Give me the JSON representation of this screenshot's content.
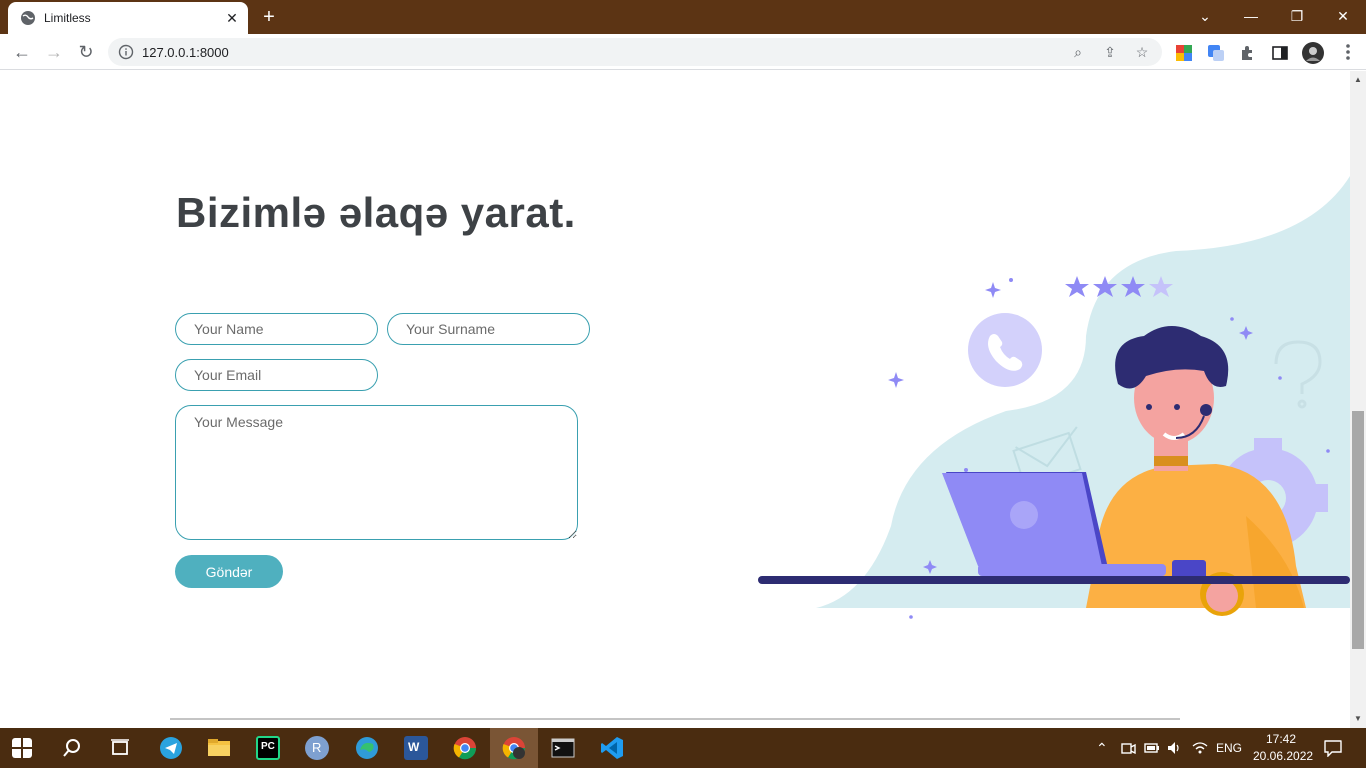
{
  "browser": {
    "tab_title": "Limitless",
    "tab_close": "✕",
    "new_tab": "+",
    "url": "127.0.0.1:8000",
    "window_controls": {
      "chevron": "⌄",
      "minimize": "—",
      "restore": "❐",
      "close": "✕"
    },
    "nav": {
      "back": "←",
      "forward": "→",
      "reload": "↻"
    },
    "omnibox_actions": {
      "zoom": "⌕",
      "share": "⇪",
      "bookmark": "☆"
    }
  },
  "page": {
    "heading": "Bizimlə əlaqə yarat.",
    "form": {
      "name_placeholder": "Your Name",
      "surname_placeholder": "Your Surname",
      "email_placeholder": "Your Email",
      "message_placeholder": "Your Message",
      "submit_label": "Göndər"
    }
  },
  "taskbar": {
    "language": "ENG",
    "time": "17:42",
    "date": "20.06.2022",
    "pycharm_label": "PC",
    "r_label": "R",
    "word_label": "W"
  },
  "colors": {
    "titlebar": "#5c3414",
    "taskbar": "#4a2c10",
    "accent": "#4fb0bf",
    "field_border": "#3aa0b0",
    "heading": "#3e4246",
    "blob": "#d5ecf0",
    "purple": "#8f8af5",
    "shirt": "#fcb044"
  }
}
